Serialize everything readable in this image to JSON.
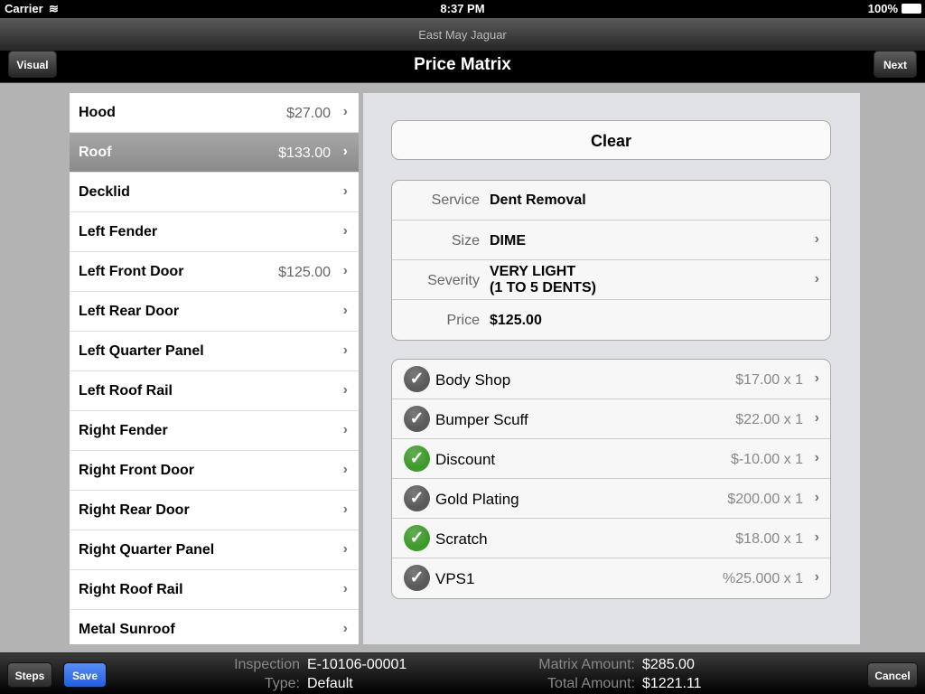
{
  "status": {
    "carrier": "Carrier",
    "time": "8:37 PM",
    "battery": "100%"
  },
  "header": {
    "subtitle": "East May Jaguar",
    "title": "Price Matrix",
    "back": "Visual",
    "next": "Next"
  },
  "parts": [
    {
      "label": "Hood",
      "price": "$27.00"
    },
    {
      "label": "Roof",
      "price": "$133.00",
      "selected": true
    },
    {
      "label": "Decklid",
      "price": ""
    },
    {
      "label": "Left Fender",
      "price": ""
    },
    {
      "label": "Left Front Door",
      "price": "$125.00"
    },
    {
      "label": "Left Rear Door",
      "price": ""
    },
    {
      "label": "Left Quarter Panel",
      "price": ""
    },
    {
      "label": "Left Roof Rail",
      "price": ""
    },
    {
      "label": "Right Fender",
      "price": ""
    },
    {
      "label": "Right Front Door",
      "price": ""
    },
    {
      "label": "Right Rear Door",
      "price": ""
    },
    {
      "label": "Right Quarter Panel",
      "price": ""
    },
    {
      "label": "Right Roof Rail",
      "price": ""
    },
    {
      "label": "Metal Sunroof",
      "price": ""
    }
  ],
  "detail": {
    "clear": "Clear",
    "service_label": "Service",
    "service": "Dent Removal",
    "size_label": "Size",
    "size": "DIME",
    "severity_label": "Severity",
    "severity1": "VERY LIGHT",
    "severity2": "(1 TO 5 DENTS)",
    "price_label": "Price",
    "price": "$125.00"
  },
  "options": [
    {
      "name": "Body Shop",
      "price": "$17.00 x 1",
      "checked_color": "#5a5a5a"
    },
    {
      "name": "Bumper Scuff",
      "price": "$22.00 x 1",
      "checked_color": "#5a5a5a"
    },
    {
      "name": "Discount",
      "price": "$-10.00 x 1",
      "checked_color": "#3d9a2a"
    },
    {
      "name": "Gold Plating",
      "price": "$200.00 x 1",
      "checked_color": "#5a5a5a"
    },
    {
      "name": "Scratch",
      "price": "$18.00 x 1",
      "checked_color": "#3d9a2a"
    },
    {
      "name": "VPS1",
      "price": "%25.000 x 1",
      "checked_color": "#5a5a5a"
    }
  ],
  "footer": {
    "steps": "Steps",
    "save": "Save",
    "cancel": "Cancel",
    "inspection_label": "Inspection",
    "inspection": "E-10106-00001",
    "type_label": "Type:",
    "type": "Default",
    "matrix_label": "Matrix Amount:",
    "matrix": "$285.00",
    "total_label": "Total Amount:",
    "total": "$1221.11"
  }
}
